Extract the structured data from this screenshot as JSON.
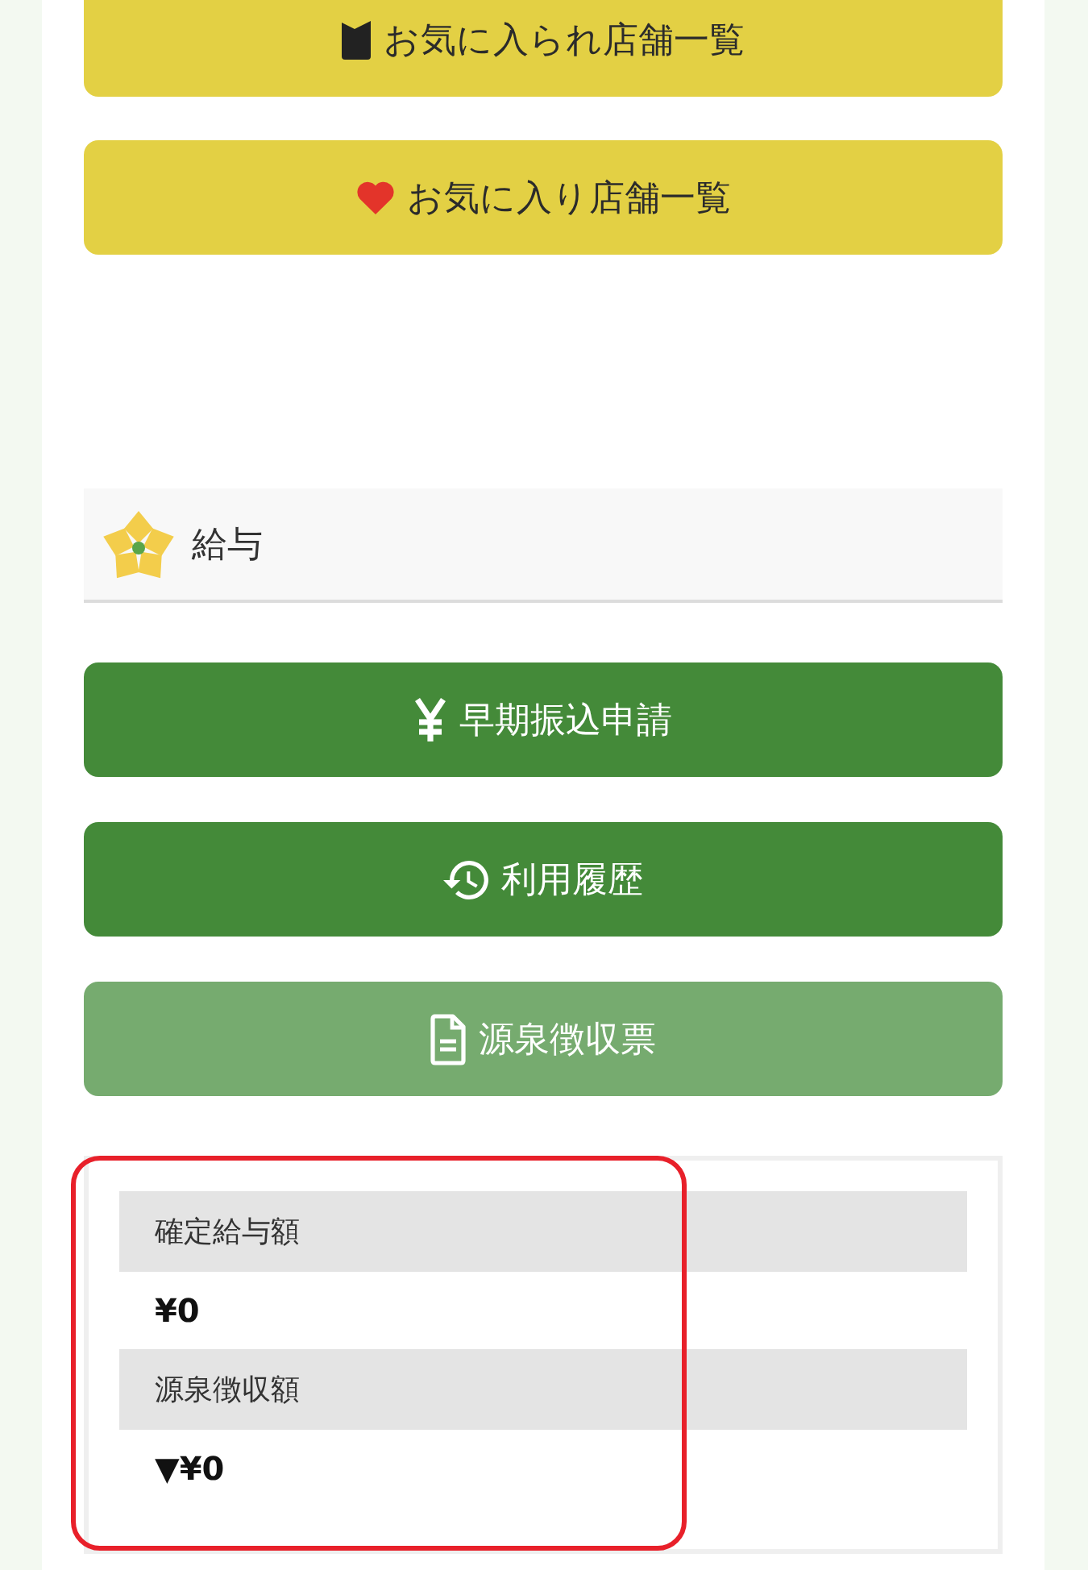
{
  "yellow_buttons": [
    {
      "label": "お気に入られ店舗一覧",
      "kind": "bookmark"
    },
    {
      "label": "お気に入り店舗一覧",
      "kind": "heart"
    }
  ],
  "section": {
    "title": "給与"
  },
  "green_buttons": [
    {
      "label": "早期振込申請",
      "kind": "yen",
      "disabled": false
    },
    {
      "label": "利用履歴",
      "kind": "history",
      "disabled": false
    },
    {
      "label": "源泉徴収票",
      "kind": "document",
      "disabled": true
    }
  ],
  "summary": {
    "rows": [
      {
        "label": "確定給与額",
        "value": "¥0"
      },
      {
        "label": "源泉徴収額",
        "value": "▼¥0"
      }
    ]
  },
  "annotation": {
    "kind": "frame"
  }
}
